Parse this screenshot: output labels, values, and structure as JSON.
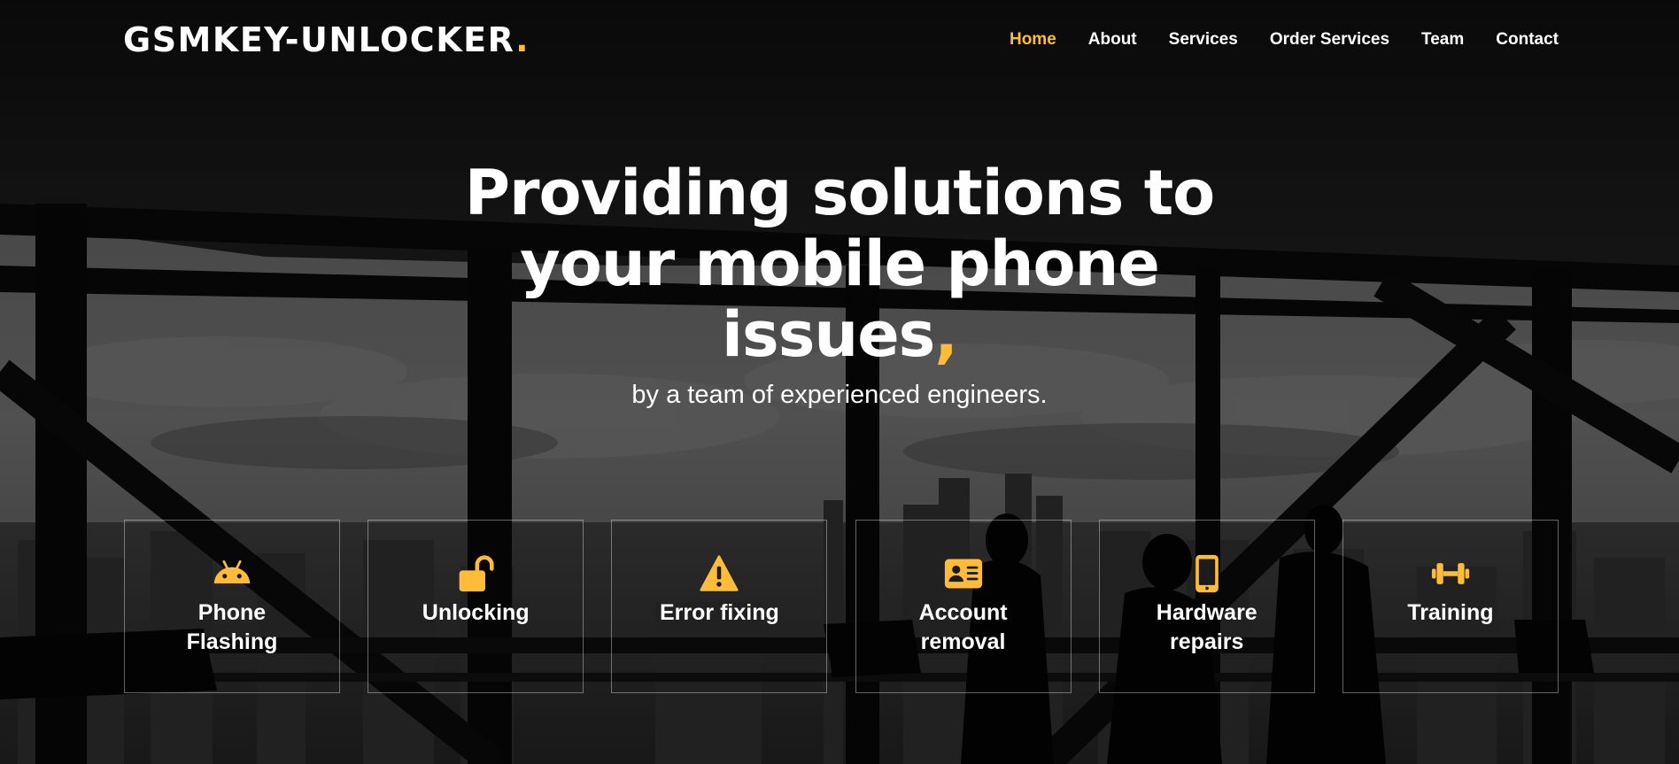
{
  "brand": {
    "name": "GSMKEY-UNLOCKER",
    "dot": ".",
    "accent_color": "#ffbc3b"
  },
  "nav": {
    "items": [
      {
        "label": "Home",
        "active": true
      },
      {
        "label": "About",
        "active": false
      },
      {
        "label": "Services",
        "active": false
      },
      {
        "label": "Order Services",
        "active": false
      },
      {
        "label": "Team",
        "active": false
      },
      {
        "label": "Contact",
        "active": false
      }
    ]
  },
  "hero": {
    "title_lines": [
      "Providing solutions to",
      "your mobile phone",
      "issues"
    ],
    "title_accent": ",",
    "subtitle": "by a team of experienced engineers."
  },
  "services": [
    {
      "label": "Phone Flashing",
      "icon": "android-icon"
    },
    {
      "label": "Unlocking",
      "icon": "unlock-icon"
    },
    {
      "label": "Error fixing",
      "icon": "warning-icon"
    },
    {
      "label": "Account removal",
      "icon": "id-card-icon"
    },
    {
      "label": "Hardware repairs",
      "icon": "mobile-phone-icon"
    },
    {
      "label": "Training",
      "icon": "dumbbell-icon"
    }
  ]
}
